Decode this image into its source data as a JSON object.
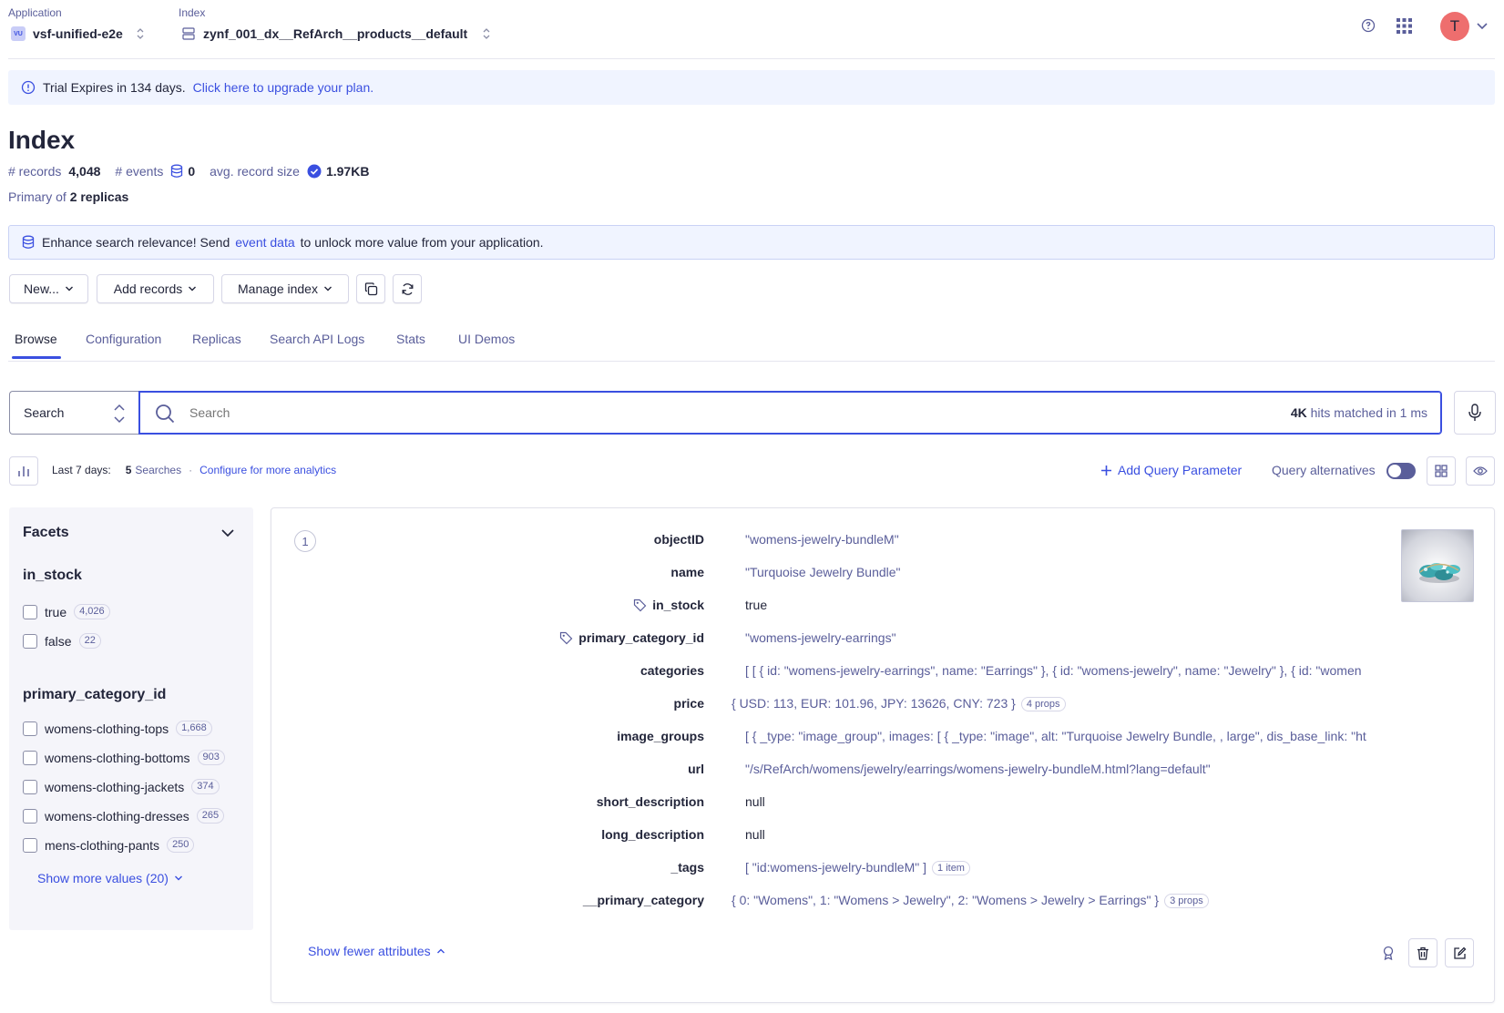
{
  "header": {
    "application_label": "Application",
    "application_badge": "VU",
    "application_name": "vsf-unified-e2e",
    "index_label": "Index",
    "index_name": "zynf_001_dx__RefArch__products__default",
    "avatar_letter": "T"
  },
  "trial": {
    "text": "Trial Expires in 134 days.",
    "link": "Click here to upgrade your plan."
  },
  "index": {
    "title": "Index",
    "records_label": "# records",
    "records_value": "4,048",
    "events_label": "# events",
    "events_value": "0",
    "avg_size_label": "avg. record size",
    "avg_size_value": "1.97KB",
    "primary_of_label": "Primary of",
    "replicas_value": "2 replicas"
  },
  "banner": {
    "text_before": "Enhance search relevance! Send",
    "link": "event data",
    "text_after": "to unlock more value from your application."
  },
  "toolbar": {
    "new_label": "New...",
    "add_records_label": "Add records",
    "manage_index_label": "Manage index"
  },
  "tabs": [
    {
      "label": "Browse"
    },
    {
      "label": "Configuration"
    },
    {
      "label": "Replicas"
    },
    {
      "label": "Search API Logs"
    },
    {
      "label": "Stats"
    },
    {
      "label": "UI Demos"
    }
  ],
  "search": {
    "mode": "Search",
    "placeholder": "Search",
    "hits_count": "4K",
    "hits_text": "hits matched in 1 ms"
  },
  "analytics": {
    "period_label": "Last 7 days:",
    "searches_count": "5",
    "searches_label": "Searches",
    "separator": "·",
    "configure_link": "Configure for more analytics",
    "add_query_param": "Add Query Parameter",
    "query_alternatives": "Query alternatives"
  },
  "facets": {
    "title": "Facets",
    "groups": [
      {
        "name": "in_stock",
        "values": [
          {
            "label": "true",
            "count": "4,026"
          },
          {
            "label": "false",
            "count": "22"
          }
        ]
      },
      {
        "name": "primary_category_id",
        "values": [
          {
            "label": "womens-clothing-tops",
            "count": "1,668"
          },
          {
            "label": "womens-clothing-bottoms",
            "count": "903"
          },
          {
            "label": "womens-clothing-jackets",
            "count": "374"
          },
          {
            "label": "womens-clothing-dresses",
            "count": "265"
          },
          {
            "label": "mens-clothing-pants",
            "count": "250"
          }
        ]
      }
    ],
    "show_more": "Show more values (20)"
  },
  "record": {
    "position": "1",
    "attributes": [
      {
        "key": "objectID",
        "value": "\"womens-jewelry-bundleM\""
      },
      {
        "key": "name",
        "value": "\"Turquoise Jewelry Bundle\""
      },
      {
        "key": "in_stock",
        "value": "true"
      },
      {
        "key": "primary_category_id",
        "value": "\"womens-jewelry-earrings\""
      },
      {
        "key": "categories",
        "value": "[ [ { id: \"womens-jewelry-earrings\", name: \"Earrings\" }, { id: \"womens-jewelry\", name: \"Jewelry\" }, { id: \"women"
      },
      {
        "key": "price",
        "value": "{ USD: 113, EUR: 101.96, JPY: 13626, CNY: 723 }",
        "pill": "4 props"
      },
      {
        "key": "image_groups",
        "value": "[ { _type: \"image_group\", images: [ { _type: \"image\", alt: \"Turquoise Jewelry Bundle, , large\", dis_base_link: \"ht"
      },
      {
        "key": "url",
        "value": "\"/s/RefArch/womens/jewelry/earrings/womens-jewelry-bundleM.html?lang=default\""
      },
      {
        "key": "short_description",
        "value": "null"
      },
      {
        "key": "long_description",
        "value": "null"
      },
      {
        "key": "_tags",
        "value": "[ \"id:womens-jewelry-bundleM\" ]",
        "pill": "1 item"
      },
      {
        "key": "__primary_category",
        "value": "{ 0: \"Womens\", 1: \"Womens > Jewelry\", 2: \"Womens > Jewelry > Earrings\" }",
        "pill": "3 props"
      }
    ],
    "show_fewer": "Show fewer attributes"
  },
  "colors": {
    "accent": "#3a4fe0",
    "trial_bg": "#f0f4ff",
    "avatar_bg": "#ee6e6e"
  }
}
